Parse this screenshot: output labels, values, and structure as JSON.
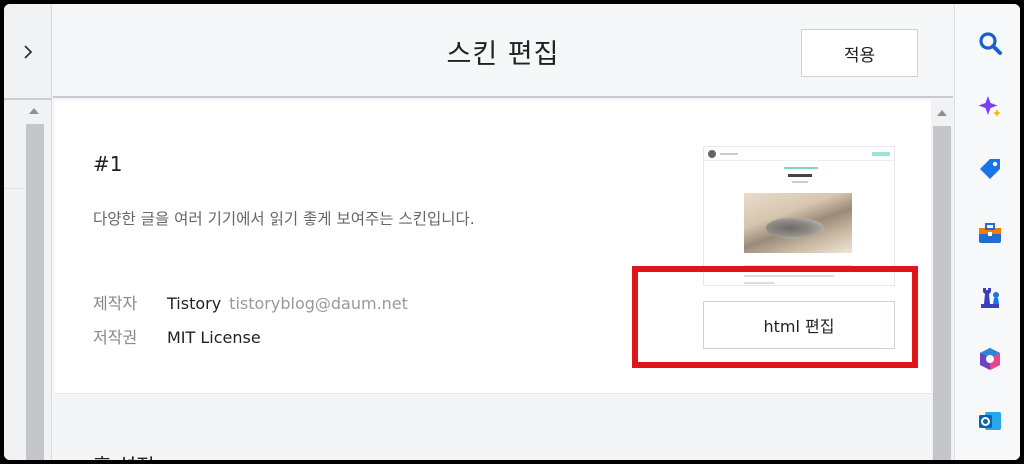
{
  "header": {
    "title": "스킨 편집",
    "apply_label": "적용"
  },
  "skin": {
    "name": "#1",
    "description": "다양한 글을 여러 기기에서 읽기 좋게 보여주는 스킨입니다.",
    "maker_label": "제작자",
    "maker_name": "Tistory",
    "maker_email": "tistoryblog@daum.net",
    "license_label": "저작권",
    "license_value": "MIT License",
    "html_edit_label": "html 편집"
  },
  "next_section": {
    "heading": "홈 설정"
  },
  "left_rail": {
    "expand_icon": "chevron-right-icon"
  },
  "right_sidebar": {
    "icons": [
      "search-icon",
      "sparkle-icon",
      "tag-icon",
      "toolbox-icon",
      "chess-icon",
      "office-icon",
      "outlook-icon"
    ]
  },
  "colors": {
    "highlight": "#e0141b",
    "accent_blue": "#1a73e8"
  }
}
